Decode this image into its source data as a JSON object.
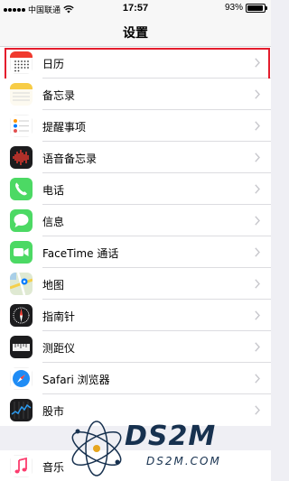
{
  "status_bar": {
    "carrier": "中国联通",
    "time": "17:57",
    "battery_percent": "93%",
    "battery_level": 0.93,
    "icons": [
      "signal-dots-icon",
      "wifi-icon",
      "battery-icon"
    ]
  },
  "nav": {
    "title": "设置"
  },
  "items": [
    {
      "label": "日历",
      "icon": "calendar-icon"
    },
    {
      "label": "备忘录",
      "icon": "notes-icon"
    },
    {
      "label": "提醒事项",
      "icon": "reminders-icon"
    },
    {
      "label": "语音备忘录",
      "icon": "voice-memos-icon"
    },
    {
      "label": "电话",
      "icon": "phone-icon"
    },
    {
      "label": "信息",
      "icon": "messages-icon"
    },
    {
      "label": "FaceTime 通话",
      "icon": "facetime-icon"
    },
    {
      "label": "地图",
      "icon": "maps-icon"
    },
    {
      "label": "指南针",
      "icon": "compass-icon"
    },
    {
      "label": "测距仪",
      "icon": "measure-icon"
    },
    {
      "label": "Safari 浏览器",
      "icon": "safari-icon"
    },
    {
      "label": "股市",
      "icon": "stocks-icon"
    }
  ],
  "music_row": {
    "label": "音乐",
    "icon": "music-icon"
  },
  "watermark": {
    "text_large": "DS2M",
    "text_small": "DS2M.COM"
  },
  "colors": {
    "highlight_border": "#e41d2d",
    "background": "#efeff4"
  }
}
